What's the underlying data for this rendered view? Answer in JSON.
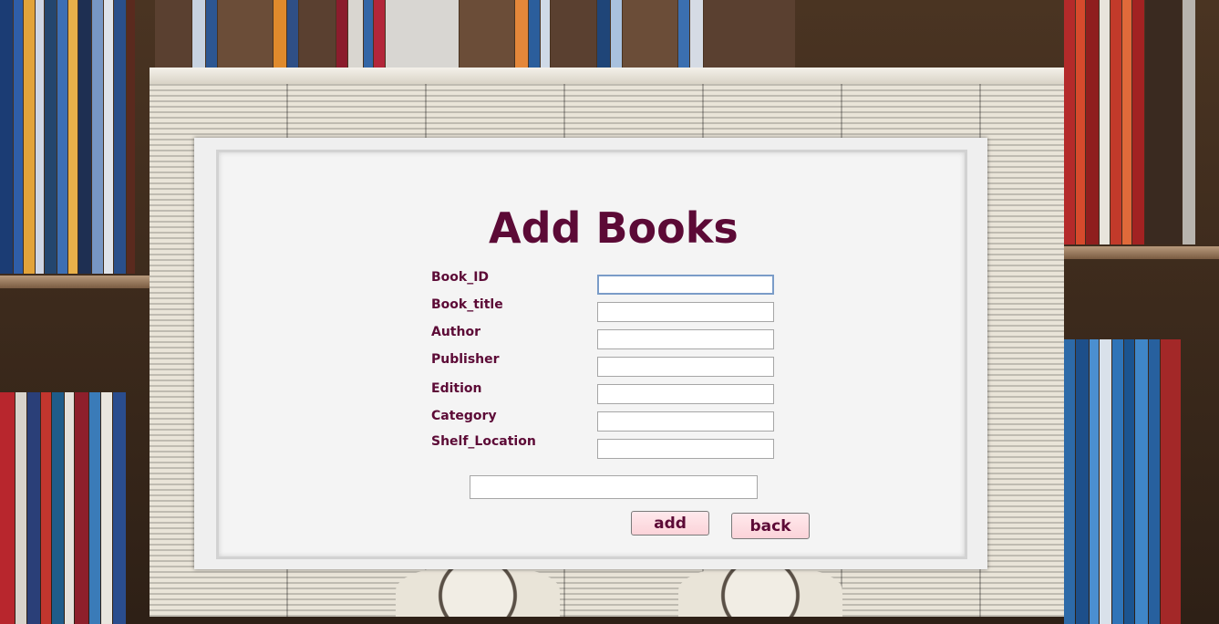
{
  "form": {
    "title": "Add Books",
    "fields": [
      {
        "label": "Book_ID",
        "value": ""
      },
      {
        "label": "Book_title",
        "value": ""
      },
      {
        "label": "Author",
        "value": ""
      },
      {
        "label": "Publisher",
        "value": ""
      },
      {
        "label": "Edition",
        "value": ""
      },
      {
        "label": "Category",
        "value": ""
      },
      {
        "label": "Shelf_Location",
        "value": ""
      }
    ],
    "status_text": "",
    "add_label": "add",
    "back_label": "back"
  },
  "colors": {
    "accent": "#5c0a36",
    "button_bg": "#fbd3d9",
    "card_bg": "#f4f4f4"
  }
}
